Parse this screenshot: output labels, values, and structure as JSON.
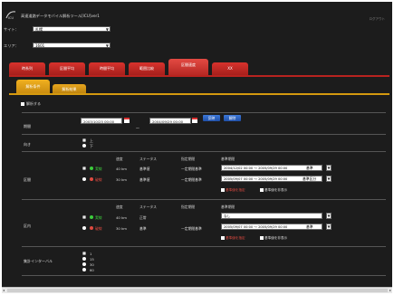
{
  "header": {
    "title": "高速道路データモバイル解析ツール[ICU]ver1",
    "corner_text": "ログアウト"
  },
  "selectors": {
    "site_label": "サイト：",
    "site_value": "札幌",
    "area_label": "エリア：",
    "area_value": "1601"
  },
  "tabs": [
    "時系列",
    "区間平均",
    "時間平均",
    "範囲比較",
    "区間速度",
    "XX"
  ],
  "active_tab_index": 4,
  "subtabs": [
    "解析条件",
    "解析結果"
  ],
  "analysis": {
    "checkbox_label": "解析する",
    "period_label": "期間",
    "start_value": "2003/10/25 00:00",
    "end_value": "2004/09/29 00:00",
    "tilde": "〜",
    "btn_apply": "反映",
    "btn_reset": "解除",
    "direction_label": "向き",
    "direction_options": [
      "上",
      "下"
    ]
  },
  "section_a": {
    "label": "区間",
    "headers": [
      "速度",
      "ステータス",
      "指定期間",
      "基準期間"
    ],
    "rows": [
      {
        "dot_color": "#3ccc3c",
        "dot_label": "実線",
        "speed": "40 km",
        "status": "基準値",
        "period": "一定期間基準",
        "range": "2004/12/02 00:00 〜 2005/09/29 00:00",
        "tag": "基準",
        "ddl": "▼"
      },
      {
        "dot_color": "#e04a40",
        "dot_label": "破線",
        "speed": "30 km",
        "status": "基準値",
        "period": "一定期間基準",
        "range": "2005/09/07 00:00 〜 2005/09/29 00:00",
        "tag": "基準区分",
        "ddl": "▼"
      }
    ],
    "legend_a": "基準値を指定",
    "legend_b": "基準値を非表示"
  },
  "section_b": {
    "label": "区内",
    "headers": [
      "速度",
      "ステータス",
      "指定期間",
      "基準期間"
    ],
    "rows": [
      {
        "dot_color": "#3ccc3c",
        "dot_label": "実線",
        "speed": "40 km",
        "status": "正常",
        "period": "",
        "range": "なし",
        "tag": "",
        "ddl": "▼"
      },
      {
        "dot_color": "#e04a40",
        "dot_label": "破線",
        "speed": "30 km",
        "status": "基準",
        "period": "一定期間基準",
        "range": "2005/09/07 00:00 〜 2005/09/29 00:00",
        "tag": "基準",
        "ddl": "▼"
      }
    ],
    "legend_a": "基準値を指定",
    "legend_b": "基準値を非表示"
  },
  "interval": {
    "label": "集計インターバル",
    "options": [
      "1",
      "15",
      "30",
      "60"
    ]
  }
}
